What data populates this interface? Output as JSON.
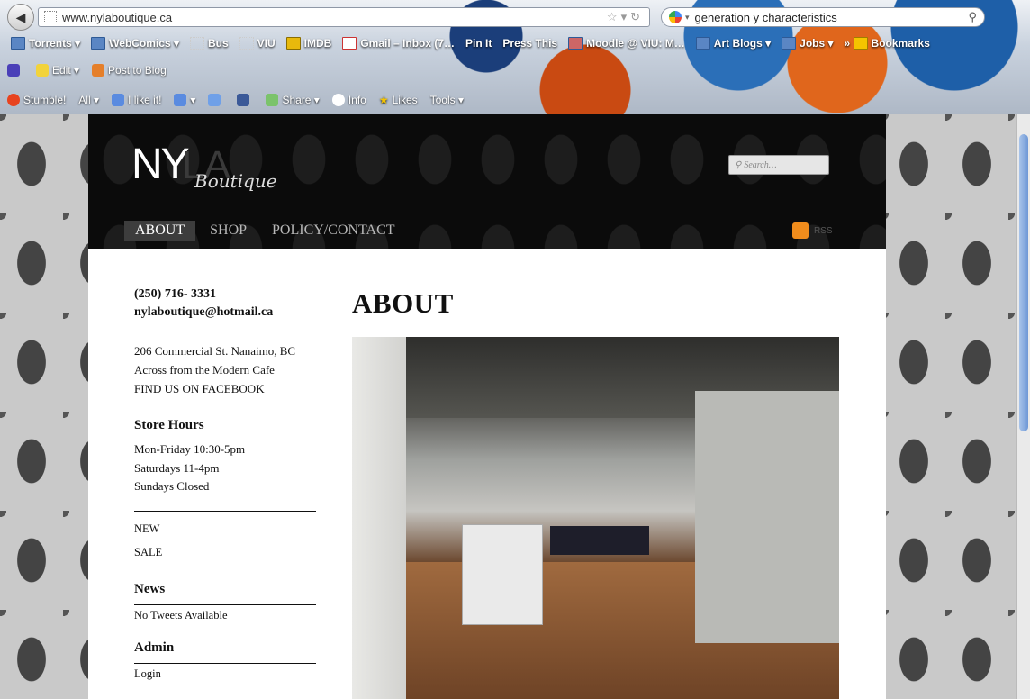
{
  "browser": {
    "url": "www.nylaboutique.ca",
    "search_query": "generation y characteristics",
    "bookmarks": [
      "Torrents",
      "WebComics",
      "Bus",
      "VIU",
      "IMDB",
      "Gmail – Inbox (7…",
      "Pin It",
      "Press This",
      "Moodle @ VIU: M…",
      "Art Blogs",
      "Jobs",
      "Bookmarks"
    ],
    "toolbar2": {
      "edit": "Edit",
      "post": "Post to Blog"
    },
    "toolbar3": {
      "stumble": "Stumble!",
      "all": "All",
      "ilike": "I like it!",
      "share": "Share",
      "info": "Info",
      "likes": "Likes",
      "tools": "Tools"
    }
  },
  "site": {
    "logo_ny": "NY",
    "logo_la": "LA",
    "logo_boutique": "Boutique",
    "search_placeholder": "Search…",
    "nav": [
      "ABOUT",
      "SHOP",
      "POLICY/CONTACT"
    ],
    "rss": "RSS"
  },
  "sidebar": {
    "phone": "(250) 716- 3331",
    "email": "nylaboutique@hotmail.ca",
    "address1": "206 Commercial St. Nanaimo, BC",
    "address2": "Across from the Modern Cafe",
    "facebook": "FIND US ON FACEBOOK",
    "hours_title": "Store Hours",
    "hours1": "Mon-Friday 10:30-5pm",
    "hours2": "Saturdays 11-4pm",
    "hours3": "Sundays Closed",
    "cats": [
      "NEW",
      "SALE"
    ],
    "news_title": "News",
    "news_text": "No Tweets Available",
    "admin_title": "Admin",
    "admin_item": "Login"
  },
  "main": {
    "title": "ABOUT"
  }
}
